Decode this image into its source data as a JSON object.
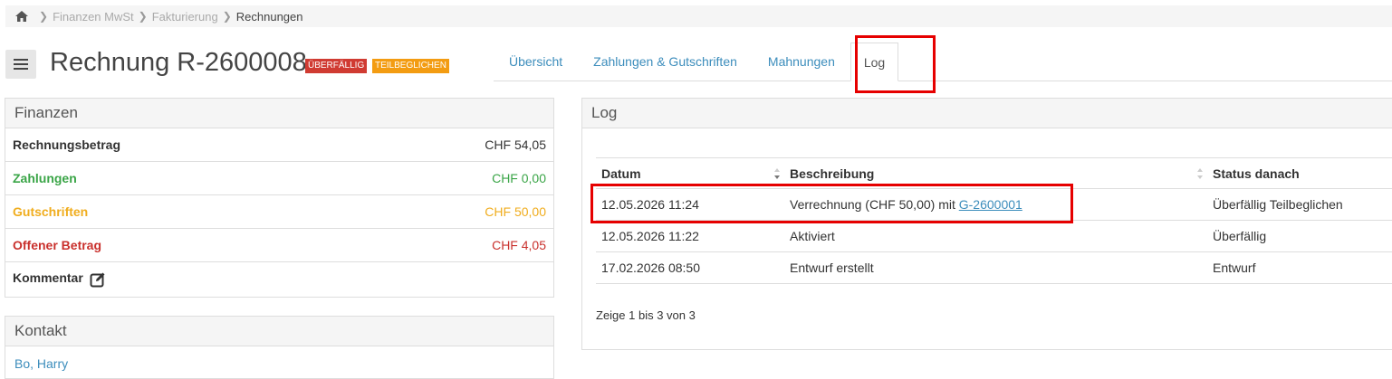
{
  "breadcrumb": {
    "home_icon": "home-icon",
    "items": [
      "Finanzen MwSt",
      "Fakturierung"
    ],
    "current": "Rechnungen"
  },
  "header": {
    "title": "Rechnung R-2600008",
    "badges": {
      "overdue": "ÜBERFÄLLIG",
      "partial": "TEILBEGLICHEN"
    },
    "colors": {
      "overdue": "#d03b32",
      "partial": "#f39c12"
    }
  },
  "tabs": [
    {
      "label": "Übersicht",
      "active": false
    },
    {
      "label": "Zahlungen & Gutschriften",
      "active": false
    },
    {
      "label": "Mahnungen",
      "active": false
    },
    {
      "label": "Log",
      "active": true
    }
  ],
  "finances": {
    "heading": "Finanzen",
    "rows": [
      {
        "label": "Rechnungsbetrag",
        "value": "CHF 54,05",
        "color": "#333333"
      },
      {
        "label": "Zahlungen",
        "value": "CHF 0,00",
        "color": "#3aa547"
      },
      {
        "label": "Gutschriften",
        "value": "CHF 50,00",
        "color": "#f0ad1e"
      },
      {
        "label": "Offener Betrag",
        "value": "CHF 4,05",
        "color": "#c9302c"
      }
    ],
    "comment_label": "Kommentar",
    "comment_icon": "edit-icon"
  },
  "contact": {
    "heading": "Kontakt",
    "name": "Bo, Harry"
  },
  "log": {
    "heading": "Log",
    "columns": [
      "Datum",
      "Beschreibung",
      "Status danach"
    ],
    "rows": [
      {
        "date": "12.05.2026 11:24",
        "desc_prefix": "Verrechnung (CHF 50,00) mit ",
        "desc_link": "G-2600001",
        "status": "Überfällig Teilbeglichen"
      },
      {
        "date": "12.05.2026 11:22",
        "desc_prefix": "Aktiviert",
        "desc_link": "",
        "status": "Überfällig"
      },
      {
        "date": "17.02.2026 08:50",
        "desc_prefix": "Entwurf erstellt",
        "desc_link": "",
        "status": "Entwurf"
      }
    ],
    "info": "Zeige 1 bis 3 von 3"
  }
}
